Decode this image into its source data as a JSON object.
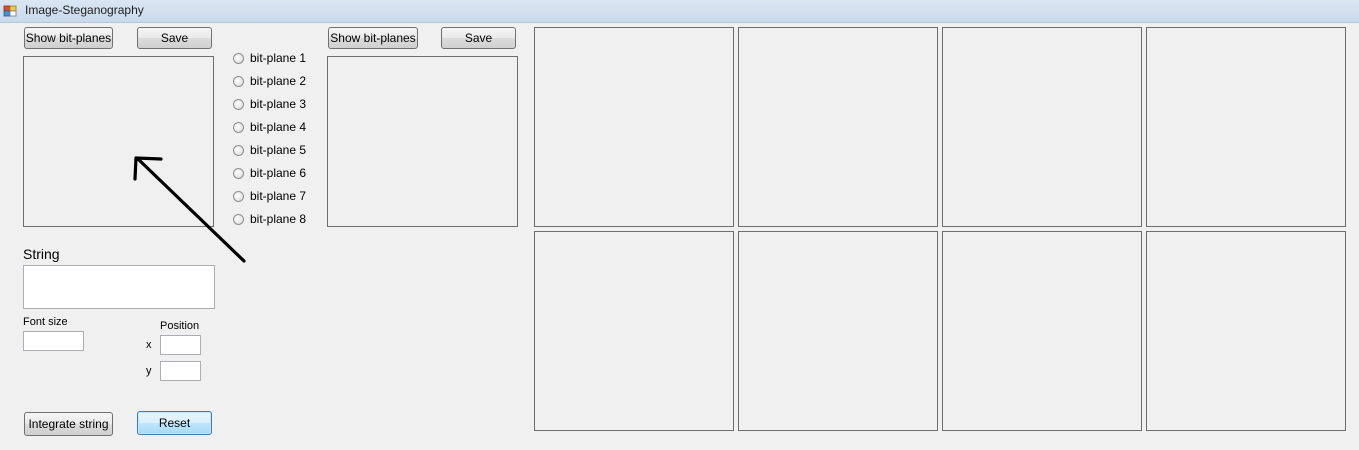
{
  "window": {
    "title": "Image-Steganography",
    "icon": "app-window-icon"
  },
  "left_panel": {
    "show_bitplanes_label": "Show bit-planes",
    "save_label": "Save",
    "string_heading": "String",
    "string_value": "",
    "font_size_label": "Font size",
    "font_size_value": "",
    "position_label": "Position",
    "x_label": "x",
    "x_value": "",
    "y_label": "y",
    "y_value": "",
    "integrate_label": "Integrate string",
    "reset_label": "Reset"
  },
  "bitplanes": {
    "options": [
      "bit-plane 1",
      "bit-plane 2",
      "bit-plane 3",
      "bit-plane 4",
      "bit-plane 5",
      "bit-plane 6",
      "bit-plane 7",
      "bit-plane 8"
    ],
    "selected": null
  },
  "middle_panel": {
    "show_bitplanes_label": "Show bit-planes",
    "save_label": "Save"
  },
  "grid": {
    "rows": 2,
    "cols": 4
  },
  "colors": {
    "background": "#f0f0f0",
    "border": "#6d6d6d",
    "default_button_border": "#3c7fb1",
    "arrow": "#000000"
  }
}
